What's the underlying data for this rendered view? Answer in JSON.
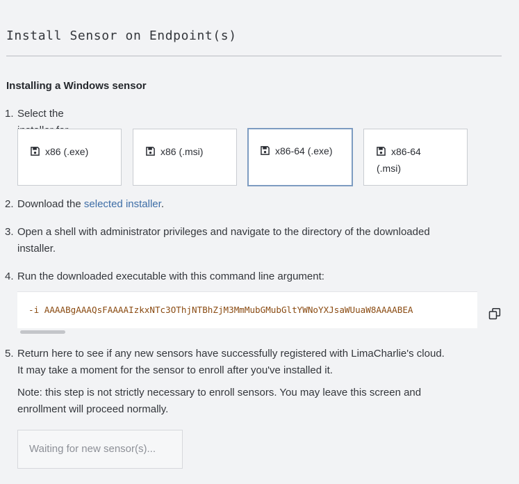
{
  "header": {
    "title": "Install Sensor on Endpoint(s)"
  },
  "section": {
    "subheading": "Installing a Windows sensor"
  },
  "steps": {
    "step1": {
      "number": "1.",
      "text": "Select the installer for your architecture."
    },
    "step2": {
      "number": "2.",
      "prefix": "Download the ",
      "link": "selected installer",
      "suffix": "."
    },
    "step3": {
      "number": "3.",
      "line1": "Open a shell with administrator privileges and navigate to the directory of the downloaded",
      "line2": "installer."
    },
    "step4": {
      "number": "4.",
      "text": "Run the downloaded executable with this command line argument:"
    },
    "step5": {
      "number": "5.",
      "line1": "Return here to see if any new sensors have successfully registered with LimaCharlie's cloud.",
      "line2": "It may take a moment for the sensor to enroll after you've installed it.",
      "note_line1": "Note: this step is not strictly necessary to enroll sensors. You may leave this screen and",
      "note_line2": "enrollment will proceed normally."
    }
  },
  "installers": [
    {
      "label": "x86 (.exe)",
      "selected": false,
      "icon": "save-icon"
    },
    {
      "label": "x86 (.msi)",
      "selected": false,
      "icon": "save-icon"
    },
    {
      "label": "x86-64 (.exe)",
      "selected": true,
      "icon": "save-icon"
    },
    {
      "label_line1": "x86-64",
      "label_line2": "(.msi)",
      "selected": false,
      "icon": "save-icon"
    }
  ],
  "command": {
    "value": "-i AAAABgAAAQsFAAAAIzkxNTc3OThjNTBhZjM3MmMubGMubGltYWNoYXJsaWUuaW8AAAABEA"
  },
  "waiting": {
    "label": "Waiting for new sensor(s)..."
  },
  "colors": {
    "accent_link": "#3d6da6",
    "command_text": "#8a4b12",
    "selected_border": "#7d9bc1"
  }
}
